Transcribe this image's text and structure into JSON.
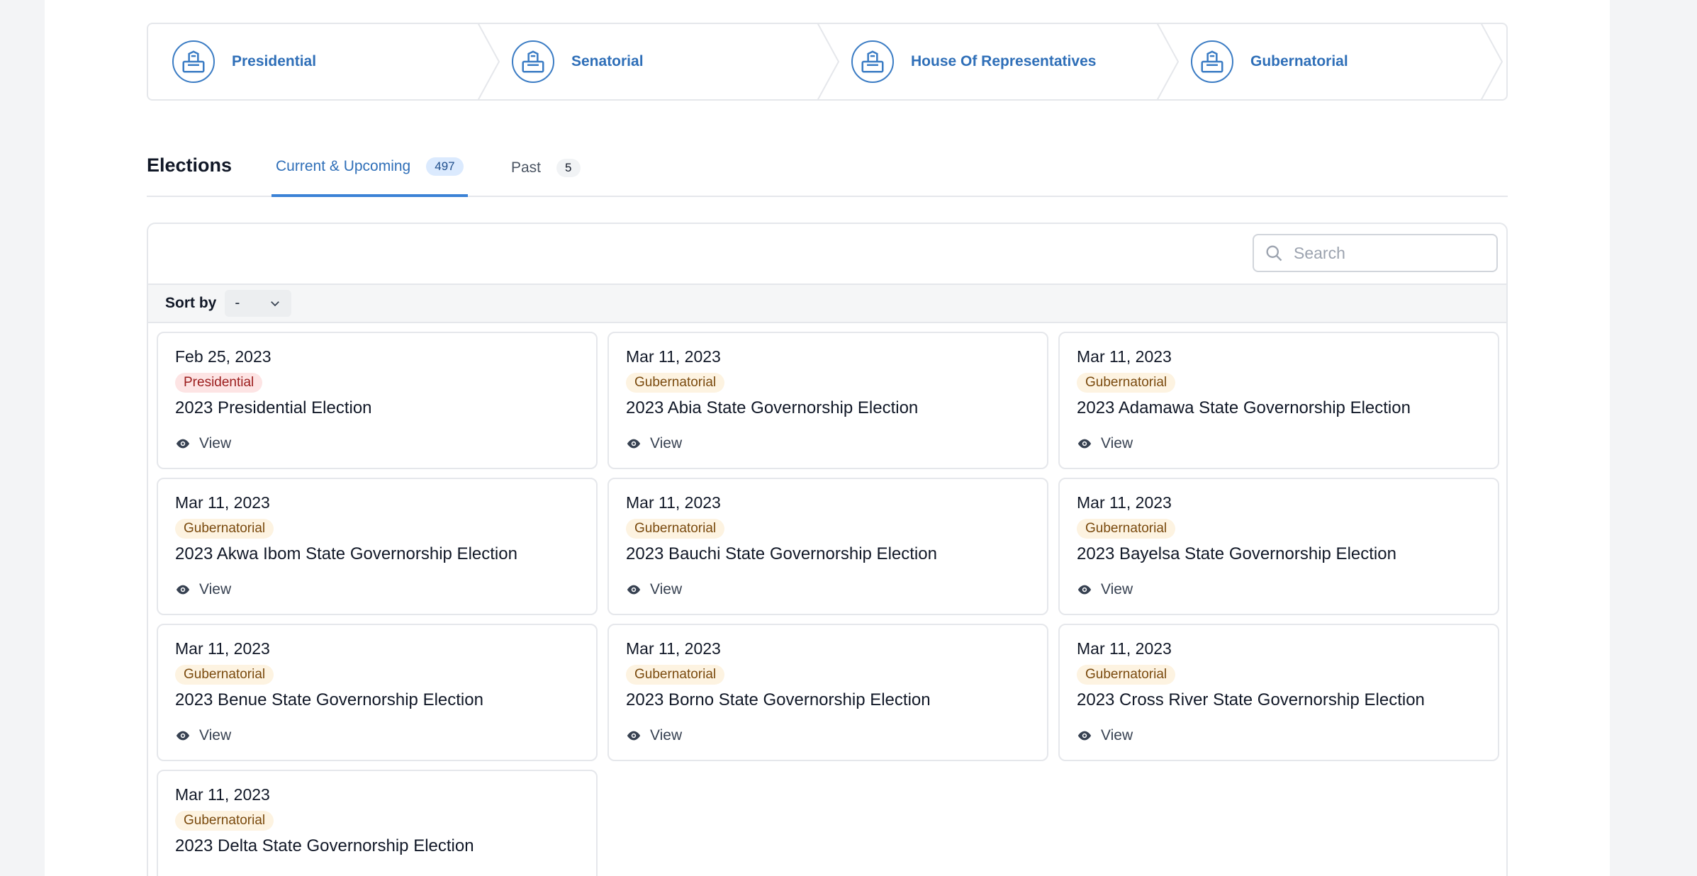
{
  "steps": [
    {
      "label": "Presidential"
    },
    {
      "label": "Senatorial"
    },
    {
      "label": "House Of Representatives"
    },
    {
      "label": "Gubernatorial"
    }
  ],
  "tabs": {
    "title": "Elections",
    "current": {
      "label": "Current & Upcoming",
      "count": "497"
    },
    "past": {
      "label": "Past",
      "count": "5"
    }
  },
  "search": {
    "placeholder": "Search"
  },
  "sort": {
    "label": "Sort by",
    "value": "-"
  },
  "view_label": "View",
  "cards": [
    {
      "date": "Feb 25, 2023",
      "badge": "Presidential",
      "title": "2023 Presidential Election"
    },
    {
      "date": "Mar 11, 2023",
      "badge": "Gubernatorial",
      "title": "2023 Abia State Governorship Election"
    },
    {
      "date": "Mar 11, 2023",
      "badge": "Gubernatorial",
      "title": "2023 Adamawa State Governorship Election"
    },
    {
      "date": "Mar 11, 2023",
      "badge": "Gubernatorial",
      "title": "2023 Akwa Ibom State Governorship Election"
    },
    {
      "date": "Mar 11, 2023",
      "badge": "Gubernatorial",
      "title": "2023 Bauchi State Governorship Election"
    },
    {
      "date": "Mar 11, 2023",
      "badge": "Gubernatorial",
      "title": "2023 Bayelsa State Governorship Election"
    },
    {
      "date": "Mar 11, 2023",
      "badge": "Gubernatorial",
      "title": "2023 Benue State Governorship Election"
    },
    {
      "date": "Mar 11, 2023",
      "badge": "Gubernatorial",
      "title": "2023 Borno State Governorship Election"
    },
    {
      "date": "Mar 11, 2023",
      "badge": "Gubernatorial",
      "title": "2023 Cross River State Governorship Election"
    },
    {
      "date": "Mar 11, 2023",
      "badge": "Gubernatorial",
      "title": "2023 Delta State Governorship Election"
    }
  ],
  "colors": {
    "accent": "#2f6fb8",
    "presidential_badge": "#9b1c1c",
    "gubernatorial_badge": "#7a4a0e"
  }
}
